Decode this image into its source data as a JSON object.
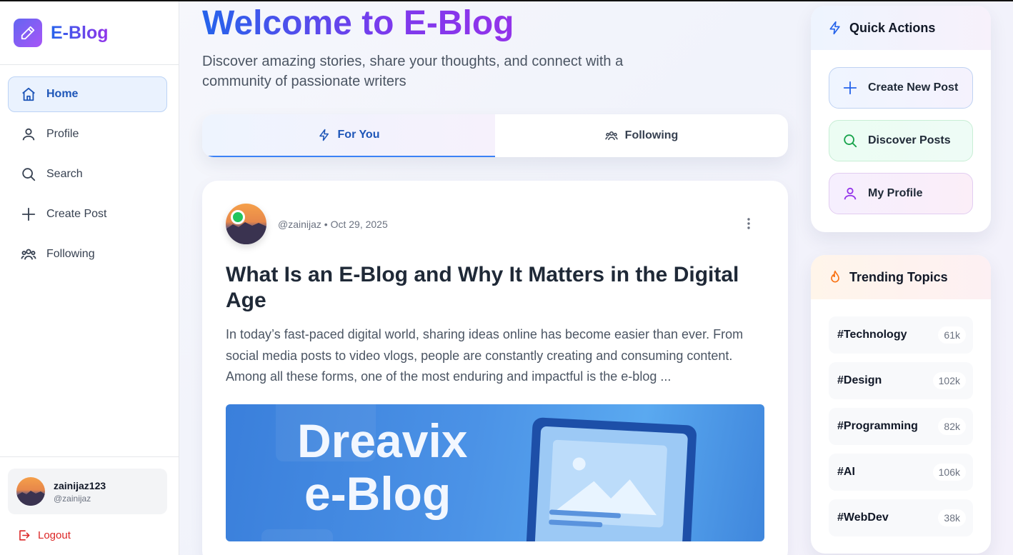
{
  "brand": {
    "name": "E-Blog"
  },
  "sidebar": {
    "items": [
      {
        "label": "Home",
        "icon": "home-icon",
        "active": true
      },
      {
        "label": "Profile",
        "icon": "user-icon"
      },
      {
        "label": "Search",
        "icon": "search-icon"
      },
      {
        "label": "Create Post",
        "icon": "plus-icon"
      },
      {
        "label": "Following",
        "icon": "users-icon"
      }
    ],
    "user": {
      "name": "zainijaz123",
      "handle": "@zainijaz"
    },
    "logout_label": "Logout"
  },
  "main": {
    "welcome": "Welcome to E-Blog",
    "subtitle": "Discover amazing stories, share your thoughts, and connect with a community of passionate writers",
    "tabs": [
      {
        "label": "For You",
        "icon": "bolt-icon",
        "active": true
      },
      {
        "label": "Following",
        "icon": "users-icon"
      }
    ],
    "post": {
      "author": "@zainijaz",
      "separator": "•",
      "date": "Oct 29, 2025",
      "title": "What Is an E-Blog and Why It Matters in the Digital Age",
      "excerpt": "In today’s fast-paced digital world, sharing ideas online has become easier than ever. From social media posts to video vlogs, people are constantly creating and consuming content. Among all these forms, one of the most enduring and impactful is the e-blog ...",
      "image": {
        "line1": "Dreavix",
        "line2": "e-Blog"
      }
    }
  },
  "quick_actions": {
    "title": "Quick Actions",
    "items": [
      {
        "label": "Create New Post",
        "icon": "plus-icon"
      },
      {
        "label": "Discover Posts",
        "icon": "search-icon"
      },
      {
        "label": "My Profile",
        "icon": "user-icon"
      }
    ]
  },
  "trending": {
    "title": "Trending Topics",
    "topics": [
      {
        "name": "#Technology",
        "count": "61k"
      },
      {
        "name": "#Design",
        "count": "102k"
      },
      {
        "name": "#Programming",
        "count": "82k"
      },
      {
        "name": "#AI",
        "count": "106k"
      },
      {
        "name": "#WebDev",
        "count": "38k"
      }
    ]
  },
  "colors": {
    "accent": "#2563eb",
    "brand_purple": "#9333ea",
    "logout": "#dc2626",
    "online": "#22c55e"
  }
}
